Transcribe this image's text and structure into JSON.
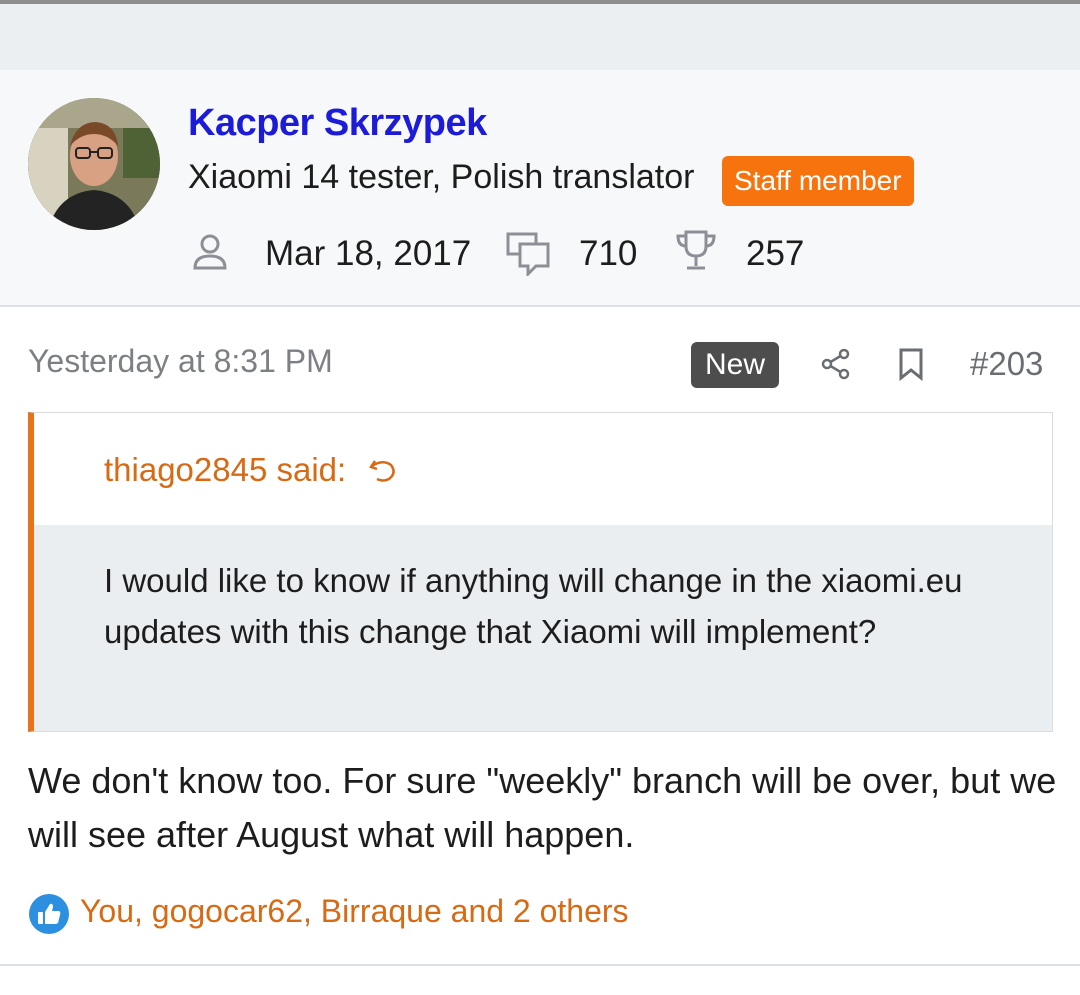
{
  "author": {
    "name": "Kacper Skrzypek",
    "title": "Xiaomi 14 tester, Polish translator",
    "badge": "Staff member",
    "joined": "Mar 18, 2017",
    "messages": "710",
    "reaction_score": "257"
  },
  "post": {
    "timestamp": "Yesterday at 8:31 PM",
    "new_label": "New",
    "number": "#203",
    "quote": {
      "attribution": "thiago2845 said:",
      "text": "I would like to know if anything will change in the xiaomi.eu updates with this change that Xiaomi will implement?"
    },
    "body": "We don't know too. For sure \"weekly\" branch will be over, but we will see after August what will happen.",
    "reactions": "You, gogocar62, Birraque and 2 others"
  },
  "colors": {
    "username": "#1c1cd8",
    "accent_orange": "#f7730e",
    "quote_orange": "#d86a14",
    "like_blue": "#2d8fe0"
  },
  "icons": [
    "user-icon",
    "comments-icon",
    "trophy-icon",
    "share-icon",
    "bookmark-icon",
    "reply-arrow-icon",
    "like-icon"
  ]
}
